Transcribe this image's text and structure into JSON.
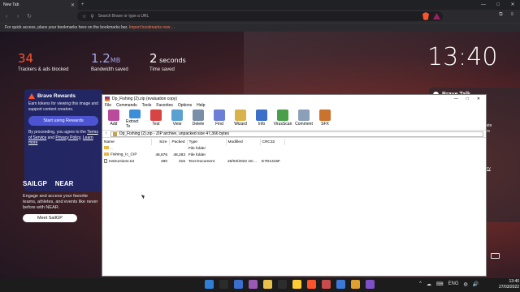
{
  "browser": {
    "tab_title": "New Tab",
    "tab_close": "✕",
    "tab_new": "+",
    "address_placeholder": "Search Brave or type a URL",
    "window_controls": [
      "—",
      "□",
      "✕"
    ],
    "toolbar_icons": [
      "⧉",
      "≡"
    ],
    "bookmarks_text": "For quick access, place your bookmarks here on the bookmarks bar.",
    "bookmarks_link": "Import bookmarks now ...",
    "accent": "#fb542b"
  },
  "stats": [
    {
      "value": "34",
      "unit": "",
      "label": "Trackers & ads blocked"
    },
    {
      "value": "1.2",
      "unit": "MB",
      "label": "Bandwidth saved"
    },
    {
      "value": "2",
      "unit": " seconds",
      "label": "Time saved"
    }
  ],
  "clock": "13:40",
  "rewards": {
    "title": "Brave Rewards",
    "body": "Earn tokens for viewing this image and support content creators.",
    "button": "Start using Rewards",
    "terms_pre": "By proceeding, you agree to the",
    "tos": "Terms of Service",
    "and": "and",
    "privacy": "Privacy Policy",
    "learn": "Learn more"
  },
  "sailgp": {
    "logo1": "SAILGP",
    "logo2": "NEAR",
    "text": "Engage and access your favorite teams, athletes, and events like never before with NEAR.",
    "button": "Meet SailGP"
  },
  "talk": {
    "title": "Brave Talk",
    "side": "k\nvate\nors",
    "link": "acy"
  },
  "winrar": {
    "title": "Dp_Fishing (2).zip (evaluation copy)",
    "window_controls": [
      "—",
      "□",
      "✕"
    ],
    "menu": [
      "File",
      "Commands",
      "Tools",
      "Favorites",
      "Options",
      "Help"
    ],
    "tools": [
      {
        "label": "Add",
        "color": "#b84b9c"
      },
      {
        "label": "Extract To",
        "color": "#3a8fd8"
      },
      {
        "label": "Test",
        "color": "#d84343"
      },
      {
        "label": "View",
        "color": "#5aa0d0"
      },
      {
        "label": "Delete",
        "color": "#7a8ea8"
      },
      {
        "label": "Find",
        "color": "#6b7fd6"
      },
      {
        "label": "Wizard",
        "color": "#d9b24a"
      },
      {
        "label": "Info",
        "color": "#3b70c8"
      },
      {
        "label": "VirusScan",
        "color": "#4aa04a"
      },
      {
        "label": "Comment",
        "color": "#8aa0b8"
      },
      {
        "label": "SFX",
        "color": "#c9732e"
      }
    ],
    "path": "Dp_Fishing (2).zip - ZIP archive, unpacked size 47,366 bytes",
    "columns": [
      "Name",
      "Size",
      "Packed",
      "Type",
      "Modified",
      "CRC32"
    ],
    "rows": [
      {
        "name": "..",
        "size": "",
        "packed": "",
        "type": "File folder",
        "modified": "",
        "crc": "",
        "icon": "folder"
      },
      {
        "name": "Fishing_Ic_CIP",
        "size": "46,876",
        "packed": "48,283",
        "type": "File folder",
        "modified": "",
        "crc": "",
        "icon": "folder"
      },
      {
        "name": "Instructions.txt",
        "size": "490",
        "packed": "315",
        "type": "Text Document",
        "modified": "26/03/2022 18:...",
        "crc": "E7D1315F",
        "icon": "text"
      }
    ]
  },
  "taskbar": {
    "apps": [
      "#2f7fd8",
      "#2b2b2b",
      "#3a6fd0",
      "#9b59b6",
      "#e8c14a",
      "#2d2d2d",
      "#ffcc33",
      "#fb542b",
      "#c94b4b",
      "#3b78d8",
      "#e0a030",
      "#7f4fc9"
    ],
    "tray": [
      "^",
      "☁",
      "⌨",
      "ENG",
      "◍",
      "🔊",
      "🔋"
    ],
    "time": "13:40",
    "date": "27/03/2022"
  }
}
